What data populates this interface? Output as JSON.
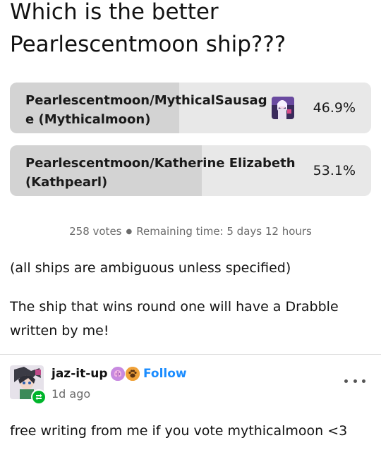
{
  "poll": {
    "title": "Which is the better Pearlescentmoon ship???",
    "options": [
      {
        "label": "Pearlescentmoon/MythicalSausage (Mythicalmoon)",
        "percent_label": "46.9%",
        "percent": 46.9,
        "has_thumbnail": true
      },
      {
        "label": "Pearlescentmoon/Katherine Elizabeth (Kathpearl)",
        "percent_label": "53.1%",
        "percent": 53.1,
        "has_thumbnail": false
      }
    ],
    "votes": "258 votes",
    "remaining": "Remaining time: 5 days 12 hours"
  },
  "body": {
    "note": "(all ships are ambiguous unless specified)",
    "drabble": "The ship that wins round one will have a Drabble written by me!"
  },
  "reblog": {
    "username": "jaz-it-up",
    "follow_label": "Follow",
    "time": "1d ago",
    "badges": [
      "brain-badge-icon",
      "paw-badge-icon"
    ],
    "comment": "free writing from me if you vote mythicalmoon <3"
  },
  "colors": {
    "accent": "#1a8cff",
    "reblog_green": "#00b52b",
    "option_bg": "#e8e8e8",
    "option_fill": "#d3d3d3"
  }
}
